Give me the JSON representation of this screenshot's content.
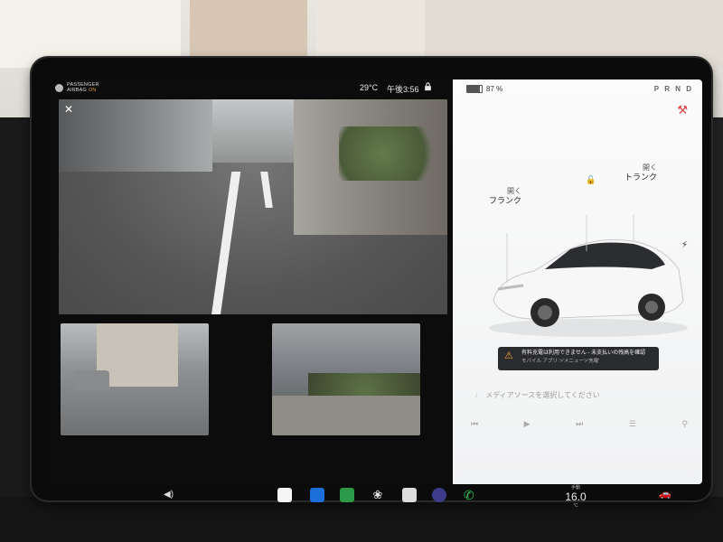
{
  "status": {
    "airbag_label_top": "PASSENGER",
    "airbag_label_bottom": "AIRBAG",
    "airbag_state": "ON",
    "temperature": "29°C",
    "time": "午後3:56"
  },
  "right_panel": {
    "battery_percent": "87 %",
    "battery_level": 0.87,
    "gear": "P R N D",
    "frunk_action": "開く",
    "frunk_label": "フランク",
    "trunk_action": "開く",
    "trunk_label": "トランク",
    "warning_title": "有料充電は利用できません - 未支払いの残高を確認",
    "warning_sub": "モバイル アプリ '>'メニュー'>'充電'",
    "media_prompt": "メディアソースを選択してください"
  },
  "camera": {
    "close_symbol": "✕"
  },
  "taskbar": {
    "volume_symbol": "◀)",
    "climate_mode": "手動",
    "climate_temp": "16.0",
    "climate_unit": "°C"
  },
  "icons": {
    "airbag": "airbag-icon",
    "lock": "lock-icon",
    "unlock": "unlock-icon",
    "driver": "driver-icon",
    "charge": "lightning-icon",
    "warning": "warning-icon",
    "music": "music-note-icon",
    "bluetooth": "bluetooth-icon",
    "fan": "fan-icon",
    "phone": "phone-icon"
  },
  "colors": {
    "airbag_on": "#e49b3a",
    "warning_accent": "#f2a93b",
    "driver_icon": "#d94040",
    "phone": "#36c95b",
    "bluetooth": "#1c6fd8",
    "energy": "#2b9a4a"
  }
}
